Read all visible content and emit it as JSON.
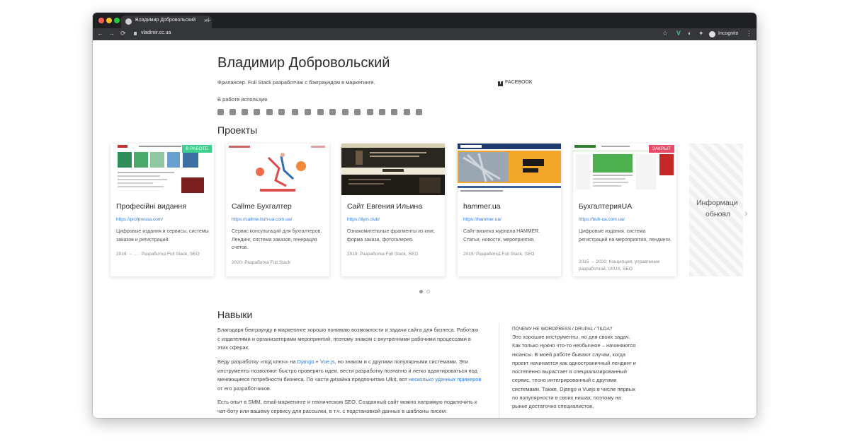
{
  "browser": {
    "tab_title": "Владимир Добровольский",
    "tab_close": "×",
    "new_tab": "+",
    "url": "vladimir.cc.ua",
    "incognito_label": "Incognito",
    "nav": {
      "back": "←",
      "forward": "→",
      "reload": "⟳"
    },
    "window_controls": {
      "close_color": "#ff5f57",
      "minimize_color": "#febc2e",
      "maximize_color": "#28c840"
    }
  },
  "header": {
    "name": "Владимир Добровольский",
    "tagline": "Фрилансер. Full Stack разработчик с бэкграундом в маркетинге.",
    "facebook": "FACEBOOK",
    "tools_label": "В работе использую",
    "tool_icons": [
      "python-icon",
      "django-icon",
      "docker-icon",
      "flask-icon",
      "wordpress-icon",
      "drupal-icon",
      "vue-icon",
      "uikit-icon",
      "bootstrap-icon",
      "wp-icon",
      "analytics-icon",
      "cms-icon",
      "hubspot-icon",
      "git-icon",
      "adobe-icon",
      "trello-icon",
      "office-icon"
    ]
  },
  "projects": {
    "heading": "Проекты",
    "cards": [
      {
        "title": "Професійні видання",
        "link": "https://profpressa.com/",
        "desc": "Цифровые издания и сервисы, системы заказов и регистраций.",
        "meta": "2019 → ... : Разработка Full Stack, SEO",
        "badge": "В РАБОТЕ",
        "badge_color": "#3ecf8e"
      },
      {
        "title": "Callme Бухгалтер",
        "link": "https://callme.buh-ua.com.ua/",
        "desc": "Сервис консультаций для бухгалтеров. Лендинг, система заказов, генерация счетов.",
        "meta": "2020: Разработка Full Stack",
        "badge": "",
        "badge_color": ""
      },
      {
        "title": "Сайт Евгения Ильина",
        "link": "https://ilyin.club/",
        "desc": "Ознакомительные фрагменты из книг, форма заказа, фотогалерея.",
        "meta": "2019: Разработка Full Stack, SEO",
        "badge": "",
        "badge_color": ""
      },
      {
        "title": "hammer.ua",
        "link": "https://hammer.ua/",
        "desc": "Сайт-визитка журнала HAMMER. Статьи, новости, мероприятия.",
        "meta": "2019: Разработка Full Stack, SEO",
        "badge": "",
        "badge_color": ""
      },
      {
        "title": "БухгалтерияUA",
        "link": "https://buh-ua.com.ua/",
        "desc": "Цифровые издания, система регистраций на мероприятия, лендинги.",
        "meta": "2015 → 2020: Концепция, управление разработкой, UI/UX, SEO",
        "badge": "ЗАКРЫТ",
        "badge_color": "#e84b6a"
      }
    ],
    "ghost_card_text": [
      "Информаци",
      "обновл"
    ],
    "next_arrow": "›"
  },
  "skills": {
    "heading": "Навыки",
    "p1": "Благодаря бекграунду в маркетинге хорошо понимаю возможности и задачи сайта для бизнеса. Работаю с издателями и организаторами мероприятий, поэтому знаком с внутренними рабочими процессами в этих сферах.",
    "p2_before": "Веду разработку «под ключ» на ",
    "p2_link1": "Django",
    "p2_plus": " + ",
    "p2_link2": "Vue.js",
    "p2_after": ", но знаком и с другими популярными системами. Эти инструменты позволяют быстро проверять идеи, вести разработку поэтапно и легко адаптироваться под меняющиеся потребности бизнеса. По части дизайна предпочитаю Ulkit, вот ",
    "p2_link3": "несколько удачных примеров",
    "p2_end": " от его разработчиков.",
    "p3": "Есть опыт в SMM, email-маркетинге и техническом SEO. Созданный сайт можно напрямую подключить к чат-боту или вашему сервису для рассылки, в т.ч. с подстановкой данных в шаблоны писем.",
    "why_heading": "ПОЧЕМУ НЕ WORDPRESS / DRUPAL / TILDA?",
    "why_text": "Это хорошие инструменты, но для своих задач. Как только нужно что-то необычное – начинаются нюансы. В моей работе бывают случаи, когда проект начинается как одностраничный лендинг и постепенно вырастает в специализированный сервис, тесно интегрированный с другими системами. Также, Django и Vuejs в числе первых по популярности в своих нишах, поэтому на рынке достаточно специалистов,"
  }
}
